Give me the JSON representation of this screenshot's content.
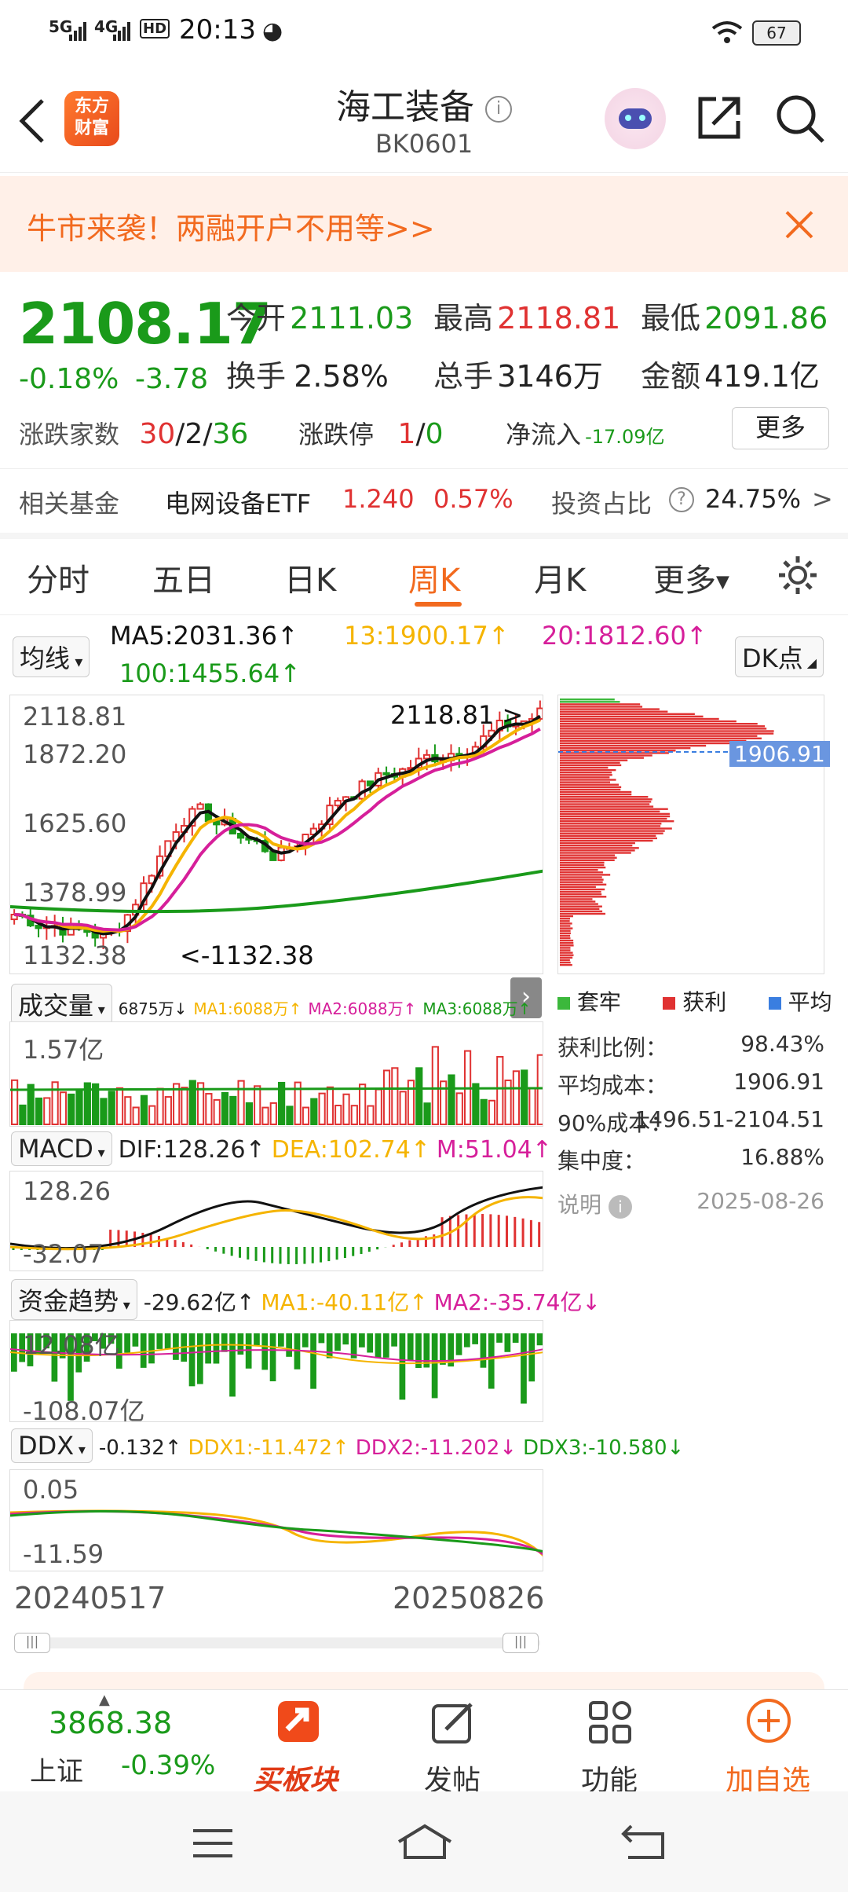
{
  "status_bar": {
    "time": "20:13",
    "net1": "5G",
    "net2": "4G",
    "hd": "HD",
    "battery": "67"
  },
  "header": {
    "logo_line1": "东方",
    "logo_line2": "财富",
    "title": "海工装备",
    "code": "BK0601"
  },
  "banner": {
    "text": "牛市来袭！两融开户不用等>>"
  },
  "quote": {
    "price": "2108.17",
    "change_pct": "-0.18%",
    "change": "-3.78",
    "open_label": "今开",
    "open": "2111.03",
    "high_label": "最高",
    "high": "2118.81",
    "low_label": "最低",
    "low": "2091.86",
    "turnover_label": "换手",
    "turnover": "2.58%",
    "volume_label": "总手",
    "volume": "3146万",
    "amount_label": "金额",
    "amount": "419.1亿",
    "breadth_label": "涨跌家数",
    "breadth_up": "30",
    "breadth_sep1": "/",
    "breadth_flat": "2",
    "breadth_sep2": "/",
    "breadth_down": "36",
    "limit_label": "涨跌停",
    "limit_up": "1",
    "limit_sep": "/",
    "limit_down": "0",
    "netflow_label": "净流入",
    "netflow": "-17.09亿",
    "more_button": "更多"
  },
  "fund_row": {
    "label": "相关基金",
    "fund_name": "电网设备ETF",
    "fund_price": "1.240",
    "fund_pct": "0.57%",
    "ratio_label": "投资占比",
    "ratio": "24.75%",
    "arrow": ">"
  },
  "tabs": [
    {
      "label": "分时",
      "active": false
    },
    {
      "label": "五日",
      "active": false
    },
    {
      "label": "日K",
      "active": false
    },
    {
      "label": "周K",
      "active": true
    },
    {
      "label": "月K",
      "active": false
    },
    {
      "label": "更多",
      "active": false
    }
  ],
  "ma_bar": {
    "selector": "均线",
    "ma5": "MA5:2031.36↑",
    "ma13": "13:1900.17↑",
    "ma20": "20:1812.60↑",
    "ma100": "100:1455.64↑",
    "dk_button": "DK点"
  },
  "kline": {
    "y_labels": [
      "2118.81",
      "1872.20",
      "1625.60",
      "1378.99",
      "1132.38"
    ],
    "max_marker": "2118.81",
    "min_marker": "1132.38",
    "colors": {
      "up": "#e03232",
      "down": "#1a9a1a",
      "ma_black": "#111111",
      "ma_yellow": "#f5b400",
      "ma_magenta": "#d61f9a",
      "ma_green": "#1a9a1a"
    }
  },
  "distribution": {
    "avg_cost_tag": "1906.91",
    "legend": [
      {
        "label": "套牢",
        "color": "#3cb83c"
      },
      {
        "label": "获利",
        "color": "#e03232"
      },
      {
        "label": "平均",
        "color": "#3a7ee0"
      }
    ],
    "stats": [
      {
        "label": "获利比例：",
        "value": "98.43%"
      },
      {
        "label": "平均成本：",
        "value": "1906.91"
      },
      {
        "label": "90%成本：",
        "value": "1496.51-2104.51"
      },
      {
        "label": "集中度：",
        "value": "16.88%"
      }
    ],
    "note_label": "说明",
    "date": "2025-08-26"
  },
  "volume_panel": {
    "selector": "成交量",
    "v": "6875万↓",
    "ma1": "MA1:6088万↑",
    "ma2": "MA2:6088万↑",
    "ma3": "MA3:6088万↑",
    "y_label": "1.57亿"
  },
  "macd_panel": {
    "selector": "MACD",
    "dif": "DIF:128.26↑",
    "dea": "DEA:102.74↑",
    "m": "M:51.04↑",
    "y_top": "128.26",
    "y_bottom": "-32.07"
  },
  "fund_panel": {
    "selector": "资金趋势",
    "v": "-29.62亿↑",
    "ma1": "MA1:-40.11亿↑",
    "ma2": "MA2:-35.74亿↓",
    "y_top": "12.08亿",
    "y_bottom": "-108.07亿"
  },
  "ddx_panel": {
    "selector": "DDX",
    "v": "-0.132↑",
    "ddx1": "DDX1:-11.472↑",
    "ddx2": "DDX2:-11.202↓",
    "ddx3": "DDX3:-10.580↓",
    "y_top": "0.05",
    "y_bottom": "-11.59"
  },
  "date_range": {
    "start": "20240517",
    "end": "20250826"
  },
  "bottom_bar": {
    "index_value": "3868.38",
    "index_name": "上证",
    "index_pct": "-0.39%",
    "buy_label": "买板块",
    "post_label": "发帖",
    "func_label": "功能",
    "watch_label": "加自选"
  }
}
